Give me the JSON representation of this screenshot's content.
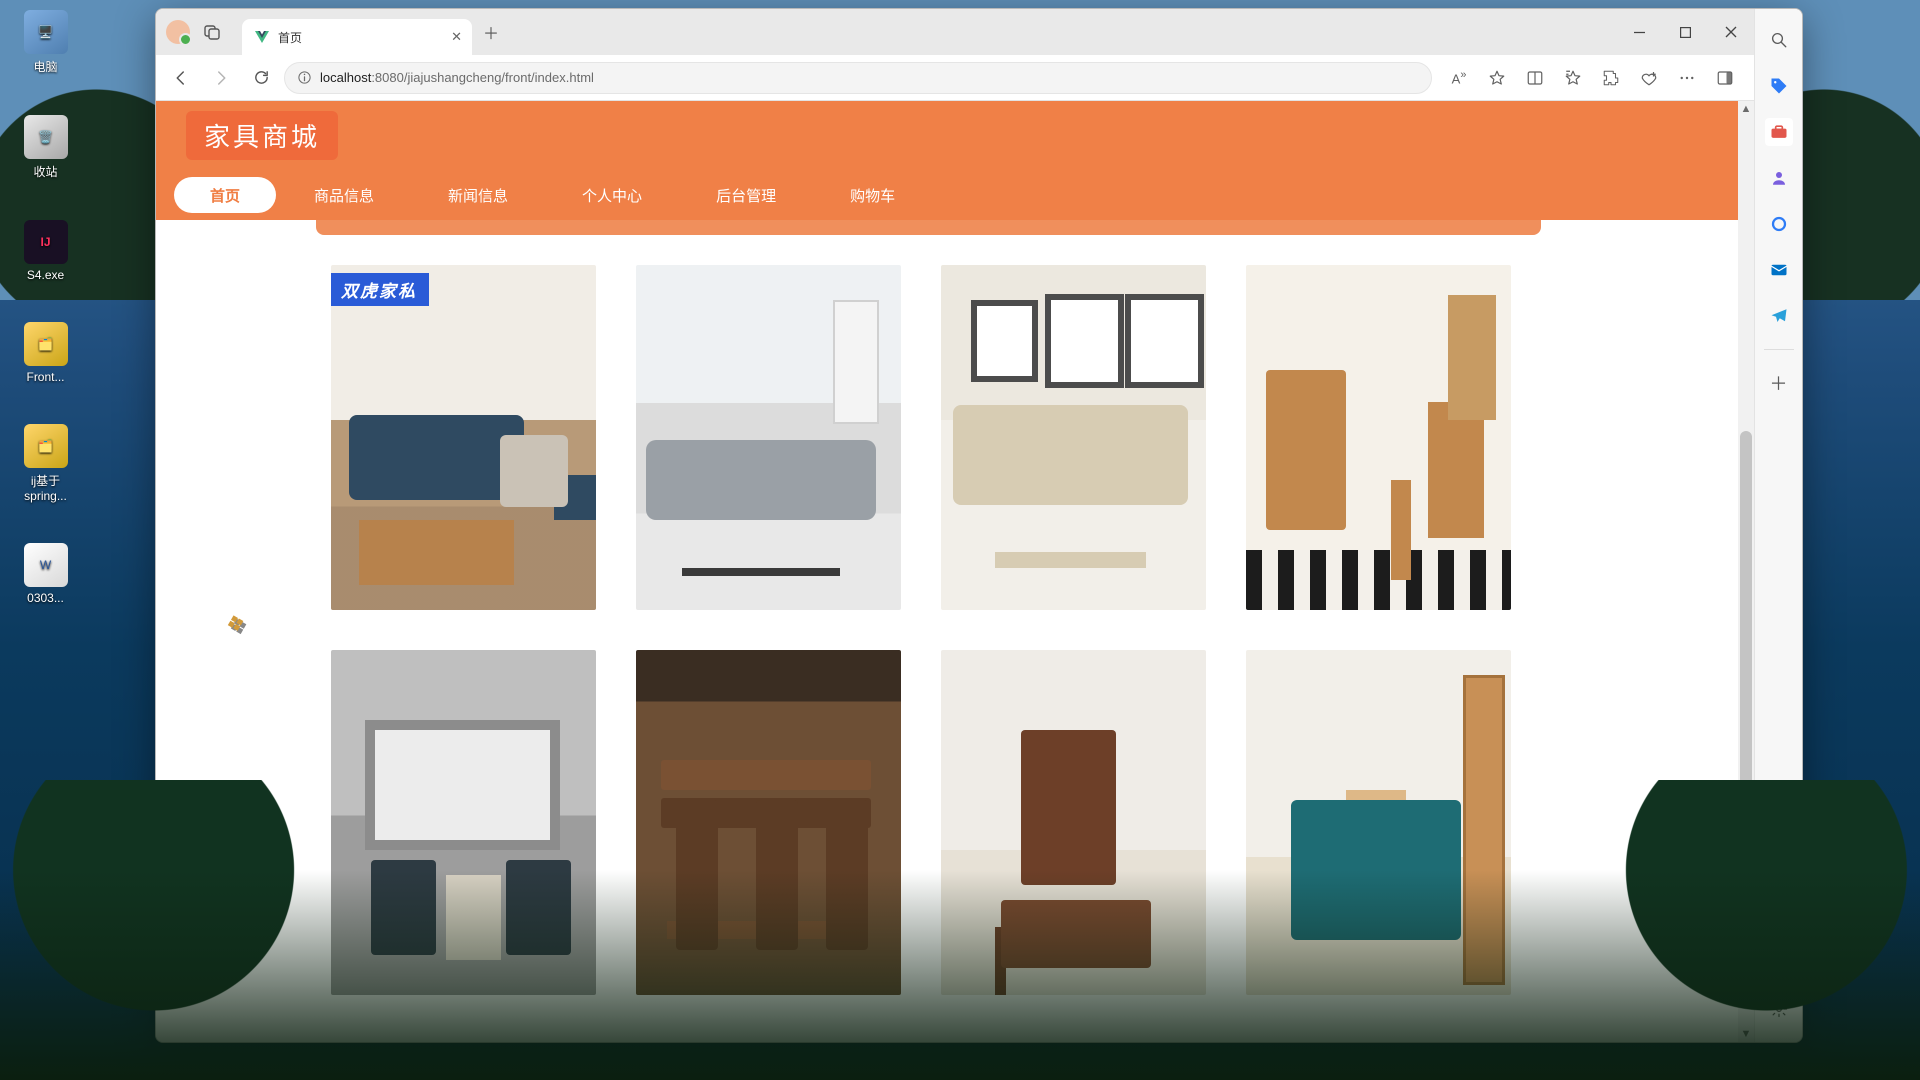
{
  "desktop_icons": [
    "电脑",
    "收站",
    "S4.exe",
    "Front...",
    "ij基于\nspring...",
    "0303..."
  ],
  "window": {
    "tab_title": "首页",
    "url_host": "localhost",
    "url_port": ":8080",
    "url_path": "/jiajushangcheng/front/index.html"
  },
  "site": {
    "logo": "家具商城",
    "nav": [
      "首页",
      "商品信息",
      "新闻信息",
      "个人中心",
      "后台管理",
      "购物车"
    ],
    "active_nav_index": 0,
    "product_badge": "双虎家私",
    "products": [
      {
        "id": "sofa-blue-wood"
      },
      {
        "id": "sofa-grey-sectional"
      },
      {
        "id": "sofa-beige-l"
      },
      {
        "id": "tv-unit-nordic"
      },
      {
        "id": "living-grey-classic"
      },
      {
        "id": "dining-walnut"
      },
      {
        "id": "cabinet-walnut"
      },
      {
        "id": "bedroom-teal"
      }
    ]
  },
  "colors": {
    "brand": "#f08047",
    "brand_dark": "#ef6a3b",
    "ribbon": "#2a5bd7"
  }
}
